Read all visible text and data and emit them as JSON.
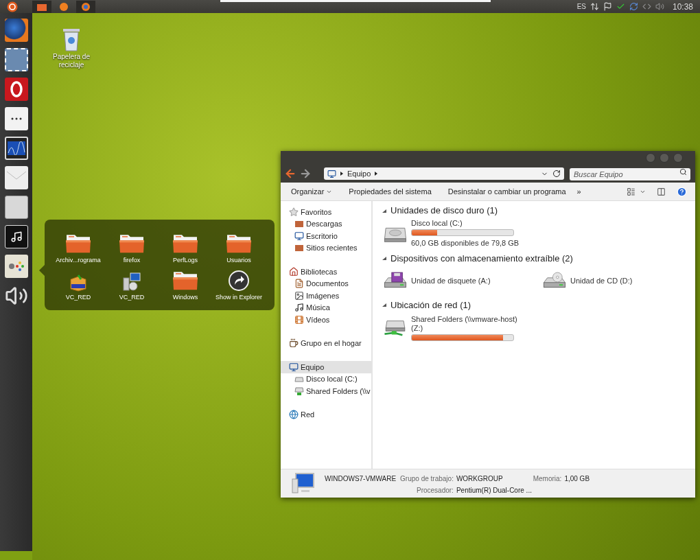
{
  "top_panel": {
    "tabs": [
      {
        "kind": "files",
        "selected": true
      },
      {
        "kind": "app",
        "selected": false
      },
      {
        "kind": "browser",
        "selected": true
      }
    ],
    "language": "ES",
    "clock": "10:38"
  },
  "desktop_icons": [
    {
      "label": "Papelera de reciclaje"
    }
  ],
  "stack_popup": {
    "items": [
      {
        "label": "Archiv...rograma",
        "kind": "folder"
      },
      {
        "label": "firefox",
        "kind": "folder"
      },
      {
        "label": "PerfLogs",
        "kind": "folder"
      },
      {
        "label": "Usuarios",
        "kind": "folder"
      },
      {
        "label": "VC_RED",
        "kind": "package"
      },
      {
        "label": "VC_RED",
        "kind": "installer"
      },
      {
        "label": "Windows",
        "kind": "folder"
      },
      {
        "label": "Show in Explorer",
        "kind": "action"
      }
    ]
  },
  "explorer": {
    "address": {
      "path": "Equipo"
    },
    "search": {
      "placeholder": "Buscar Equipo"
    },
    "toolbar": [
      {
        "label": "Organizar",
        "kind": "menu"
      },
      {
        "label": "Propiedades del sistema",
        "kind": "button"
      },
      {
        "label": "Desinstalar o cambiar un programa",
        "kind": "button"
      },
      {
        "label": "»",
        "kind": "overflow"
      }
    ],
    "nav": [
      {
        "label": "Favoritos",
        "kind": "star",
        "selected": false,
        "children": [
          {
            "label": "Descargas",
            "kind": "folder",
            "selected": false
          },
          {
            "label": "Escritorio",
            "kind": "desktop",
            "selected": false
          },
          {
            "label": "Sitios recientes",
            "kind": "folder",
            "selected": false
          }
        ]
      },
      {
        "label": "Bibliotecas",
        "kind": "home",
        "selected": false,
        "children": [
          {
            "label": "Documentos",
            "kind": "doc",
            "selected": false
          },
          {
            "label": "Imágenes",
            "kind": "image",
            "selected": false
          },
          {
            "label": "Música",
            "kind": "music",
            "selected": false
          },
          {
            "label": "Vídeos",
            "kind": "video",
            "selected": false
          }
        ]
      },
      {
        "label": "Grupo en el hogar",
        "kind": "cup",
        "selected": false
      },
      {
        "label": "Equipo",
        "kind": "computer",
        "selected": true,
        "children": [
          {
            "label": "Disco local (C:)",
            "kind": "hdd",
            "selected": false
          },
          {
            "label": "Shared Folders (\\\\v",
            "kind": "network",
            "selected": false
          }
        ]
      },
      {
        "label": "Red",
        "kind": "globe",
        "selected": false
      }
    ],
    "sections": [
      {
        "title": "Unidades de disco duro (1)",
        "items": [
          {
            "name": "Disco local (C:)",
            "kind": "hdd",
            "level": 0.25,
            "detail": "60,0 GB disponibles de 79,8 GB"
          }
        ]
      },
      {
        "title": "Dispositivos con almacenamiento extraíble (2)",
        "items": [
          {
            "name": "Unidad de disquete (A:)",
            "kind": "floppy"
          },
          {
            "name": "Unidad de CD (D:)",
            "kind": "cd"
          }
        ]
      },
      {
        "title": "Ubicación de red (1)",
        "items": [
          {
            "name": "Shared Folders (\\\\vmware-host) (Z:)",
            "kind": "network",
            "level": 0.9
          }
        ]
      }
    ],
    "details": {
      "computer": "WINDOWS7-VMWARE",
      "fields": [
        {
          "label": "Grupo de trabajo:",
          "value": "WORKGROUP"
        },
        {
          "label": "Memoria:",
          "value": "1,00 GB"
        },
        {
          "label": "Procesador:",
          "value": "Pentium(R) Dual-Core ..."
        }
      ]
    }
  }
}
